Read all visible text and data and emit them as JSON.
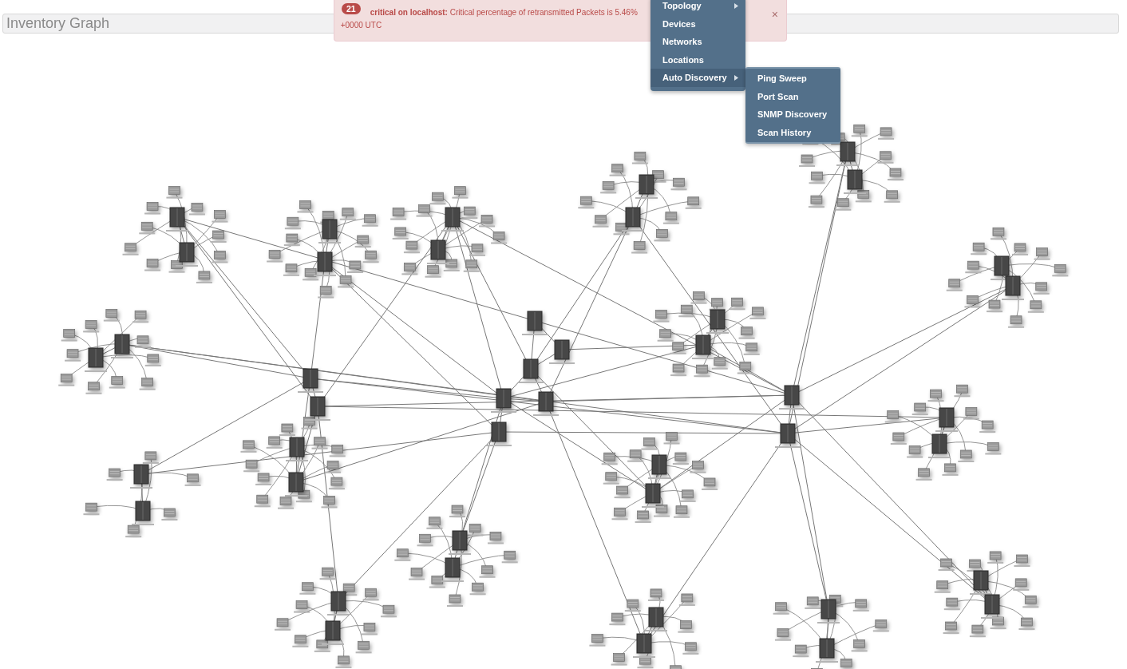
{
  "header": {
    "title": "Inventory Graph"
  },
  "alert": {
    "count": "21",
    "message": "**critical on localhost:** Critical percentage of retransmitted Packets is 5.46%",
    "message_tail": "+0000 UTC",
    "close": "×"
  },
  "menu": {
    "items": [
      {
        "label": "Topology",
        "has_submenu": true,
        "selected": false
      },
      {
        "label": "Devices",
        "has_submenu": false,
        "selected": false
      },
      {
        "label": "Networks",
        "has_submenu": false,
        "selected": false
      },
      {
        "label": "Locations",
        "has_submenu": false,
        "selected": false
      },
      {
        "label": "Auto Discovery",
        "has_submenu": true,
        "selected": true
      }
    ],
    "submenu": {
      "items": [
        {
          "label": "Ping Sweep",
          "selected": false
        },
        {
          "label": "Port Scan",
          "selected": false
        },
        {
          "label": "SNMP Discovery",
          "selected": false
        },
        {
          "label": "Scan History",
          "selected": false
        }
      ]
    }
  }
}
